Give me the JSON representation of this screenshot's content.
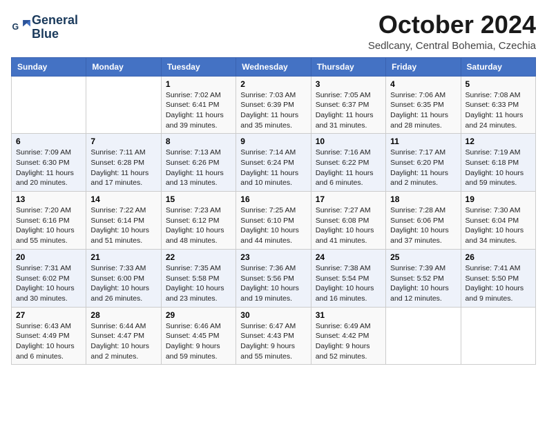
{
  "logo": {
    "line1": "General",
    "line2": "Blue"
  },
  "title": "October 2024",
  "subtitle": "Sedlcany, Central Bohemia, Czechia",
  "header_days": [
    "Sunday",
    "Monday",
    "Tuesday",
    "Wednesday",
    "Thursday",
    "Friday",
    "Saturday"
  ],
  "weeks": [
    [
      {
        "day": "",
        "sunrise": "",
        "sunset": "",
        "daylight": ""
      },
      {
        "day": "",
        "sunrise": "",
        "sunset": "",
        "daylight": ""
      },
      {
        "day": "1",
        "sunrise": "Sunrise: 7:02 AM",
        "sunset": "Sunset: 6:41 PM",
        "daylight": "Daylight: 11 hours and 39 minutes."
      },
      {
        "day": "2",
        "sunrise": "Sunrise: 7:03 AM",
        "sunset": "Sunset: 6:39 PM",
        "daylight": "Daylight: 11 hours and 35 minutes."
      },
      {
        "day": "3",
        "sunrise": "Sunrise: 7:05 AM",
        "sunset": "Sunset: 6:37 PM",
        "daylight": "Daylight: 11 hours and 31 minutes."
      },
      {
        "day": "4",
        "sunrise": "Sunrise: 7:06 AM",
        "sunset": "Sunset: 6:35 PM",
        "daylight": "Daylight: 11 hours and 28 minutes."
      },
      {
        "day": "5",
        "sunrise": "Sunrise: 7:08 AM",
        "sunset": "Sunset: 6:33 PM",
        "daylight": "Daylight: 11 hours and 24 minutes."
      }
    ],
    [
      {
        "day": "6",
        "sunrise": "Sunrise: 7:09 AM",
        "sunset": "Sunset: 6:30 PM",
        "daylight": "Daylight: 11 hours and 20 minutes."
      },
      {
        "day": "7",
        "sunrise": "Sunrise: 7:11 AM",
        "sunset": "Sunset: 6:28 PM",
        "daylight": "Daylight: 11 hours and 17 minutes."
      },
      {
        "day": "8",
        "sunrise": "Sunrise: 7:13 AM",
        "sunset": "Sunset: 6:26 PM",
        "daylight": "Daylight: 11 hours and 13 minutes."
      },
      {
        "day": "9",
        "sunrise": "Sunrise: 7:14 AM",
        "sunset": "Sunset: 6:24 PM",
        "daylight": "Daylight: 11 hours and 10 minutes."
      },
      {
        "day": "10",
        "sunrise": "Sunrise: 7:16 AM",
        "sunset": "Sunset: 6:22 PM",
        "daylight": "Daylight: 11 hours and 6 minutes."
      },
      {
        "day": "11",
        "sunrise": "Sunrise: 7:17 AM",
        "sunset": "Sunset: 6:20 PM",
        "daylight": "Daylight: 11 hours and 2 minutes."
      },
      {
        "day": "12",
        "sunrise": "Sunrise: 7:19 AM",
        "sunset": "Sunset: 6:18 PM",
        "daylight": "Daylight: 10 hours and 59 minutes."
      }
    ],
    [
      {
        "day": "13",
        "sunrise": "Sunrise: 7:20 AM",
        "sunset": "Sunset: 6:16 PM",
        "daylight": "Daylight: 10 hours and 55 minutes."
      },
      {
        "day": "14",
        "sunrise": "Sunrise: 7:22 AM",
        "sunset": "Sunset: 6:14 PM",
        "daylight": "Daylight: 10 hours and 51 minutes."
      },
      {
        "day": "15",
        "sunrise": "Sunrise: 7:23 AM",
        "sunset": "Sunset: 6:12 PM",
        "daylight": "Daylight: 10 hours and 48 minutes."
      },
      {
        "day": "16",
        "sunrise": "Sunrise: 7:25 AM",
        "sunset": "Sunset: 6:10 PM",
        "daylight": "Daylight: 10 hours and 44 minutes."
      },
      {
        "day": "17",
        "sunrise": "Sunrise: 7:27 AM",
        "sunset": "Sunset: 6:08 PM",
        "daylight": "Daylight: 10 hours and 41 minutes."
      },
      {
        "day": "18",
        "sunrise": "Sunrise: 7:28 AM",
        "sunset": "Sunset: 6:06 PM",
        "daylight": "Daylight: 10 hours and 37 minutes."
      },
      {
        "day": "19",
        "sunrise": "Sunrise: 7:30 AM",
        "sunset": "Sunset: 6:04 PM",
        "daylight": "Daylight: 10 hours and 34 minutes."
      }
    ],
    [
      {
        "day": "20",
        "sunrise": "Sunrise: 7:31 AM",
        "sunset": "Sunset: 6:02 PM",
        "daylight": "Daylight: 10 hours and 30 minutes."
      },
      {
        "day": "21",
        "sunrise": "Sunrise: 7:33 AM",
        "sunset": "Sunset: 6:00 PM",
        "daylight": "Daylight: 10 hours and 26 minutes."
      },
      {
        "day": "22",
        "sunrise": "Sunrise: 7:35 AM",
        "sunset": "Sunset: 5:58 PM",
        "daylight": "Daylight: 10 hours and 23 minutes."
      },
      {
        "day": "23",
        "sunrise": "Sunrise: 7:36 AM",
        "sunset": "Sunset: 5:56 PM",
        "daylight": "Daylight: 10 hours and 19 minutes."
      },
      {
        "day": "24",
        "sunrise": "Sunrise: 7:38 AM",
        "sunset": "Sunset: 5:54 PM",
        "daylight": "Daylight: 10 hours and 16 minutes."
      },
      {
        "day": "25",
        "sunrise": "Sunrise: 7:39 AM",
        "sunset": "Sunset: 5:52 PM",
        "daylight": "Daylight: 10 hours and 12 minutes."
      },
      {
        "day": "26",
        "sunrise": "Sunrise: 7:41 AM",
        "sunset": "Sunset: 5:50 PM",
        "daylight": "Daylight: 10 hours and 9 minutes."
      }
    ],
    [
      {
        "day": "27",
        "sunrise": "Sunrise: 6:43 AM",
        "sunset": "Sunset: 4:49 PM",
        "daylight": "Daylight: 10 hours and 6 minutes."
      },
      {
        "day": "28",
        "sunrise": "Sunrise: 6:44 AM",
        "sunset": "Sunset: 4:47 PM",
        "daylight": "Daylight: 10 hours and 2 minutes."
      },
      {
        "day": "29",
        "sunrise": "Sunrise: 6:46 AM",
        "sunset": "Sunset: 4:45 PM",
        "daylight": "Daylight: 9 hours and 59 minutes."
      },
      {
        "day": "30",
        "sunrise": "Sunrise: 6:47 AM",
        "sunset": "Sunset: 4:43 PM",
        "daylight": "Daylight: 9 hours and 55 minutes."
      },
      {
        "day": "31",
        "sunrise": "Sunrise: 6:49 AM",
        "sunset": "Sunset: 4:42 PM",
        "daylight": "Daylight: 9 hours and 52 minutes."
      },
      {
        "day": "",
        "sunrise": "",
        "sunset": "",
        "daylight": ""
      },
      {
        "day": "",
        "sunrise": "",
        "sunset": "",
        "daylight": ""
      }
    ]
  ]
}
